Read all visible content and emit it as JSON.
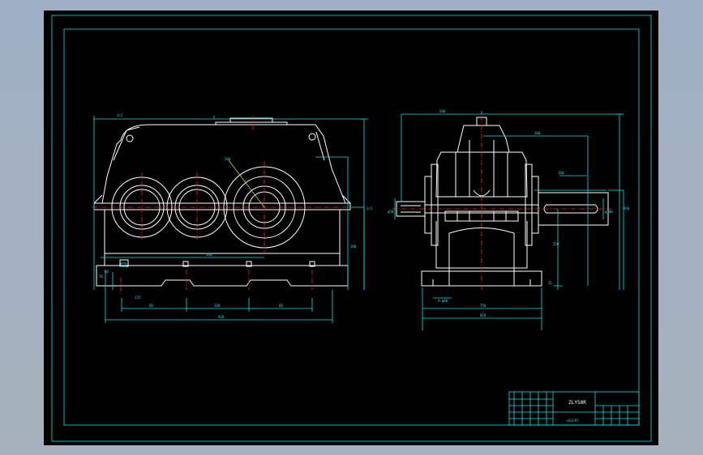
{
  "title_block": {
    "drawing_name": "ZLY50R",
    "drawing_code": "n61/R7"
  }
}
